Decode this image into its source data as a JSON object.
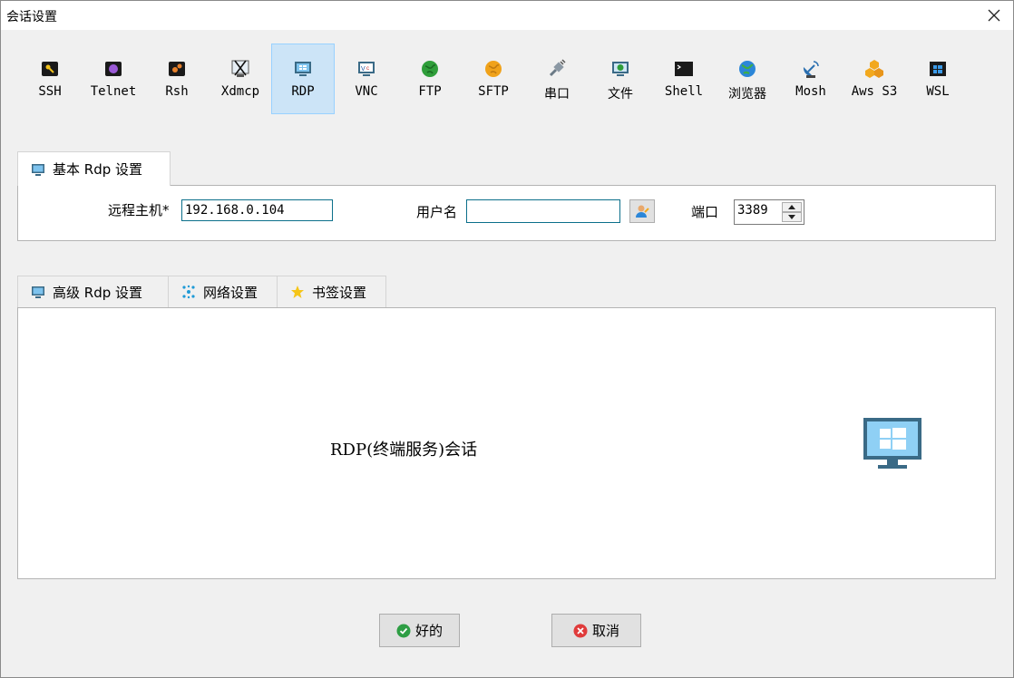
{
  "window": {
    "title": "会话设置"
  },
  "session_types": [
    {
      "label": "SSH",
      "icon": "key-icon",
      "selected": false
    },
    {
      "label": "Telnet",
      "icon": "telnet-icon",
      "selected": false
    },
    {
      "label": "Rsh",
      "icon": "rsh-icon",
      "selected": false
    },
    {
      "label": "Xdmcp",
      "icon": "xdmcp-icon",
      "selected": false
    },
    {
      "label": "RDP",
      "icon": "rdp-monitor-icon",
      "selected": true
    },
    {
      "label": "VNC",
      "icon": "vnc-icon",
      "selected": false
    },
    {
      "label": "FTP",
      "icon": "ftp-globe-icon",
      "selected": false
    },
    {
      "label": "SFTP",
      "icon": "sftp-globe-icon",
      "selected": false
    },
    {
      "label": "串口",
      "icon": "serial-plug-icon",
      "selected": false
    },
    {
      "label": "文件",
      "icon": "file-monitor-icon",
      "selected": false
    },
    {
      "label": "Shell",
      "icon": "terminal-icon",
      "selected": false
    },
    {
      "label": "浏览器",
      "icon": "browser-globe-icon",
      "selected": false
    },
    {
      "label": "Mosh",
      "icon": "satellite-icon",
      "selected": false
    },
    {
      "label": "Aws S3",
      "icon": "aws-cubes-icon",
      "selected": false
    },
    {
      "label": "WSL",
      "icon": "windows-icon",
      "selected": false
    }
  ],
  "basic_tab": {
    "label": "基本 Rdp 设置"
  },
  "basic": {
    "host_label": "远程主机*",
    "host_value": "192.168.0.104",
    "username_label": "用户名",
    "username_value": "",
    "port_label": "端口",
    "port_value": "3389"
  },
  "advanced_tabs": [
    {
      "label": "高级 Rdp 设置",
      "icon": "monitor-icon"
    },
    {
      "label": "网络设置",
      "icon": "network-icon"
    },
    {
      "label": "书签设置",
      "icon": "star-icon"
    }
  ],
  "description": "RDP(终端服务)会话",
  "buttons": {
    "ok": "好的",
    "cancel": "取消"
  },
  "colors": {
    "selected_bg": "#cce4f7",
    "accent": "#0b6f8a",
    "ok_green": "#2e9e44",
    "cancel_red": "#e03b3b"
  }
}
